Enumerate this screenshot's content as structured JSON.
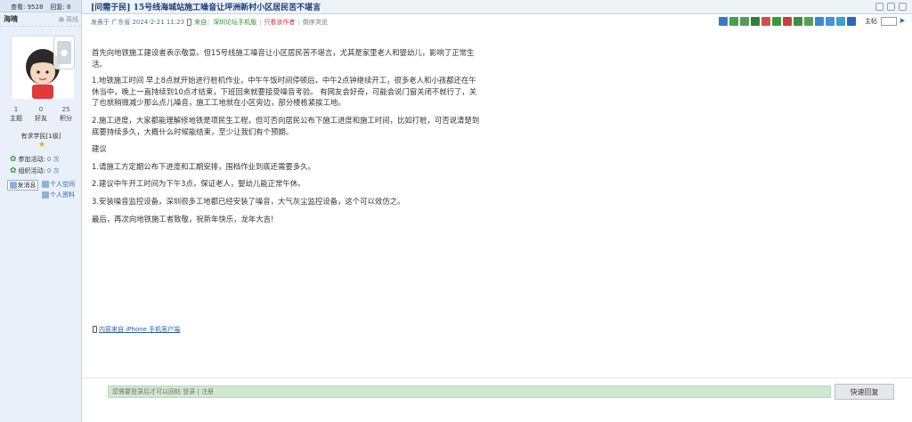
{
  "sidebar": {
    "views_label": "查看: 9528",
    "replies_label": "回复: 8",
    "username": "海晴",
    "status": "离线",
    "stats": [
      {
        "value": "1",
        "label": "主题"
      },
      {
        "value": "0",
        "label": "好友"
      },
      {
        "value": "25",
        "label": "积分"
      }
    ],
    "level": "有求学民[1级]",
    "activity_join": "参加活动:",
    "activity_join_count": "0 次",
    "activity_org": "组织活动:",
    "activity_org_count": "0 次",
    "send_message": "发消息",
    "personal_space": "个人空间",
    "personal_profile": "个人资料"
  },
  "post": {
    "title": "[问需于民] 15号线海城站施工噪音让坪洲新村小区居民苦不堪言",
    "meta_posted": "发表于 广东省 2024-2-21 11:23",
    "meta_source": "来自：深圳论坛手机版",
    "meta_author_only": "只看该作者",
    "meta_reverse": "倒序浏览",
    "jump_label": "主帖",
    "paragraphs": [
      "首先向地铁施工建设者表示敬意。但15号线施工噪音让小区居民苦不堪言，尤其是家里老人和婴幼儿，影响了正常生活。",
      "1.地铁施工时间 早上8点就开始进行桩机作业，中午午饭时间停顿后，中午2点钟继续开工，很多老人和小孩都还在午休当中，晚上一直持续到10点才结束，下班回来就要接受噪音考验。 有网友会好奇，可能会说门窗关闭不就行了，关了也就稍微减少那么点儿噪音，施工工地就在小区旁边，部分楼栋紧挨工地。",
      "2.施工进度，大家都能理解修地铁是项民生工程，但可否向居民公布下施工进度和施工时间，比如打桩，可否说清楚到底要持续多久，大概什么时候能结束，至少让我们有个预期。",
      "建议",
      "1.请施工方定期公布下进度和工期安排，围档作业到底还需要多久。",
      "2.建议中午开工时间为下午3点，保证老人，婴幼儿能正常午休。",
      "3.安装噪音监控设备，深圳很多工地都已经安装了噪音，大气灰尘监控设备，这个可以效仿之。",
      "最后，再次向地铁施工者致敬，祝新年快乐，龙年大吉!"
    ],
    "client_line": "内容来自 iPhone 手机客户端"
  },
  "reply": {
    "placeholder": "您需要登录后才可以回帖 登录 | 注册",
    "button": "快速回复"
  },
  "colors": {
    "sidebar_bg": "#e9f0fa",
    "title_color": "#1a3d7c",
    "reply_input_bg": "#cfe8cf"
  }
}
